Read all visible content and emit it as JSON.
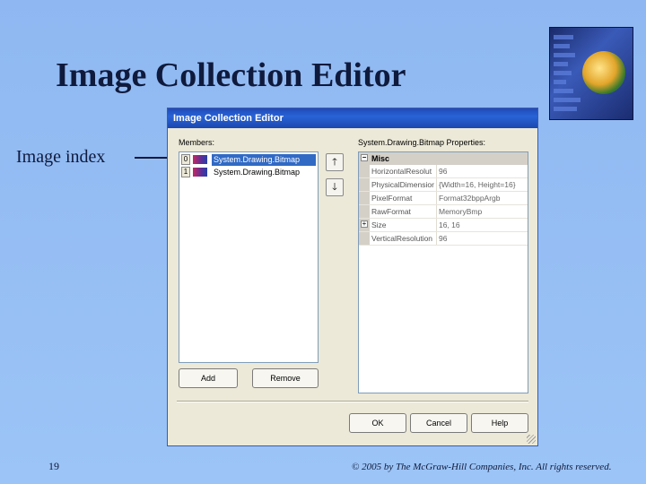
{
  "slide": {
    "title": "Image Collection Editor",
    "annotation": "Image index",
    "page_number": "19",
    "copyright": "© 2005 by The McGraw-Hill Companies, Inc. All rights reserved."
  },
  "dialog": {
    "title": "Image Collection Editor",
    "members_label": "Members:",
    "members": [
      {
        "index": "0",
        "label": "System.Drawing.Bitmap",
        "selected": true
      },
      {
        "index": "1",
        "label": "System.Drawing.Bitmap",
        "selected": false
      }
    ],
    "move_up_icon": "arrow-up-icon",
    "move_down_icon": "arrow-down-icon",
    "properties_label": "System.Drawing.Bitmap Properties:",
    "category": "Misc",
    "properties": [
      {
        "name": "HorizontalResolut",
        "value": "96"
      },
      {
        "name": "PhysicalDimensior",
        "value": "{Width=16, Height=16}"
      },
      {
        "name": "PixelFormat",
        "value": "Format32bppArgb"
      },
      {
        "name": "RawFormat",
        "value": "MemoryBmp"
      },
      {
        "name": "Size",
        "value": "16, 16"
      },
      {
        "name": "VerticalResolution",
        "value": "96"
      }
    ],
    "buttons": {
      "add": "Add",
      "remove": "Remove",
      "ok": "OK",
      "cancel": "Cancel",
      "help": "Help"
    }
  },
  "colors": {
    "background": "#9cc4f6",
    "title_bar": "#2963d5",
    "selection": "#316ac5",
    "text": "#0f1a3c"
  }
}
